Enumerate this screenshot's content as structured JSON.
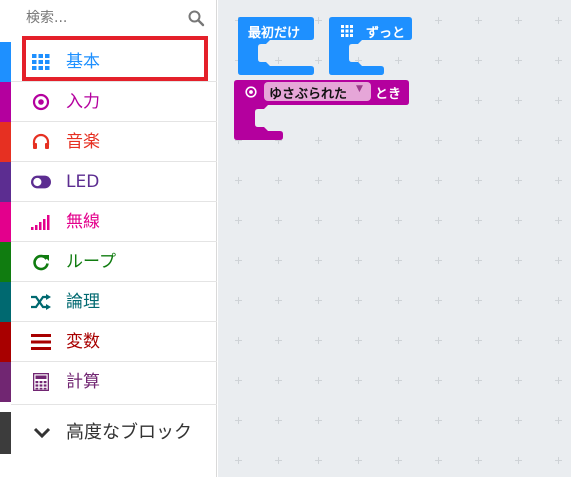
{
  "search": {
    "placeholder": "検索..."
  },
  "categories": [
    {
      "label": "基本",
      "icon": "grid-icon",
      "color": "#1e90ff"
    },
    {
      "label": "入力",
      "icon": "target-icon",
      "color": "#b4009e"
    },
    {
      "label": "音楽",
      "icon": "headphones-icon",
      "color": "#e63022"
    },
    {
      "label": "LED",
      "icon": "toggle-icon",
      "color": "#5c2d91"
    },
    {
      "label": "無線",
      "icon": "signal-icon",
      "color": "#e3008c"
    },
    {
      "label": "ループ",
      "icon": "loop-icon",
      "color": "#107c10"
    },
    {
      "label": "論理",
      "icon": "shuffle-icon",
      "color": "#006970"
    },
    {
      "label": "変数",
      "icon": "variable-icon",
      "color": "#a80000"
    },
    {
      "label": "計算",
      "icon": "calculator-icon",
      "color": "#712672"
    }
  ],
  "advanced": {
    "label": "高度なブロック",
    "icon": "chevron-down-icon"
  },
  "blocks": {
    "on_start": {
      "label": "最初だけ",
      "color": "#1e90ff"
    },
    "forever": {
      "label": "ずっと",
      "color": "#1e90ff",
      "icon": "grid-icon"
    },
    "on_gesture": {
      "dropdown_value": "ゆさぶられた",
      "suffix": "とき",
      "color": "#b4009e",
      "icon": "target-icon"
    }
  }
}
